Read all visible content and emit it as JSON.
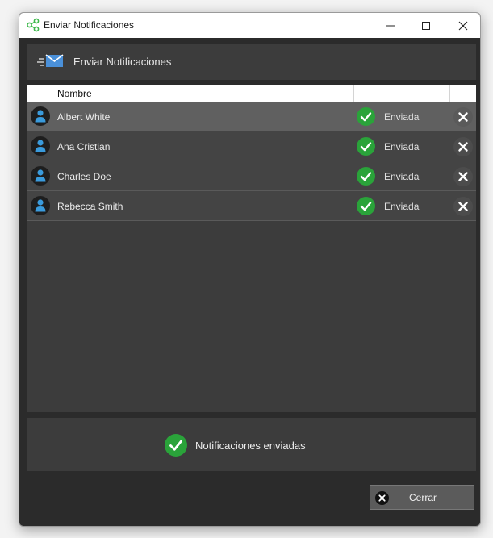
{
  "window": {
    "title": "Enviar Notificaciones",
    "app_icon": "share-nodes-icon"
  },
  "header": {
    "title": "Enviar Notificaciones",
    "icon": "envelope-send-icon"
  },
  "table": {
    "columns": [
      "",
      "Nombre",
      "",
      "",
      ""
    ],
    "rows": [
      {
        "name": "Albert White",
        "status": "Enviada",
        "selected": true
      },
      {
        "name": "Ana Cristian",
        "status": "Enviada",
        "selected": false
      },
      {
        "name": "Charles Doe",
        "status": "Enviada",
        "selected": false
      },
      {
        "name": "Rebecca Smith",
        "status": "Enviada",
        "selected": false
      }
    ]
  },
  "footer": {
    "message": "Notificaciones enviadas",
    "icon": "check-circle-icon"
  },
  "buttons": {
    "close_label": "Cerrar"
  },
  "colors": {
    "success": "#2aa33a",
    "window_bg": "#2b2b2b",
    "panel_bg": "#3c3c3c",
    "selected_row": "#606060",
    "avatar_accent": "#3a9bdc"
  }
}
